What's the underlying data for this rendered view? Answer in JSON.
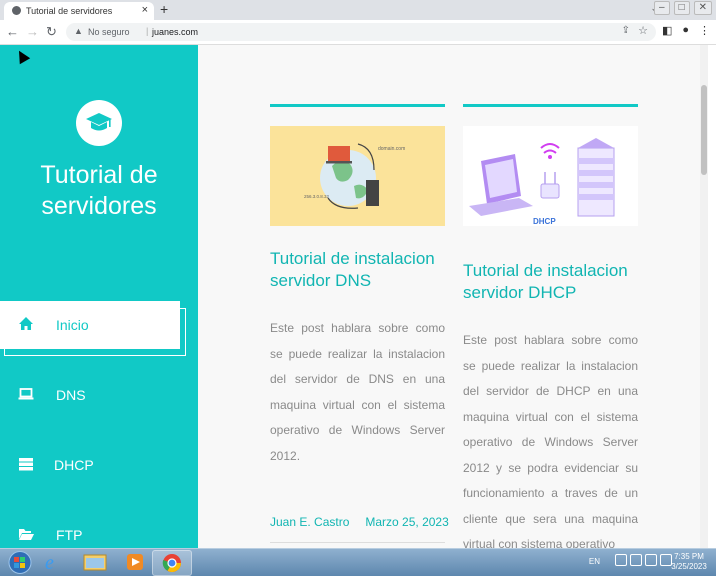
{
  "browser": {
    "tab_title": "Tutorial de servidores",
    "not_secure": "No seguro",
    "url": "juanes.com"
  },
  "sidebar": {
    "site_title": "Tutorial de servidores",
    "items": [
      {
        "label": "Inicio",
        "icon": "home-icon",
        "active": true
      },
      {
        "label": "DNS",
        "icon": "laptop-icon",
        "active": false
      },
      {
        "label": "DHCP",
        "icon": "server-icon",
        "active": false
      },
      {
        "label": "FTP",
        "icon": "folder-open-icon",
        "active": false
      }
    ]
  },
  "posts": [
    {
      "title": "Tutorial de instalacion servidor DNS",
      "image_caption": "domain.com",
      "image_ip": "256.3.0.8.32",
      "text": "Este post hablara sobre como se puede realizar la instalacion del servidor de DNS en una maquina virtual con el sistema operativo de Windows Server 2012.",
      "author": "Juan E. Castro",
      "date": "Marzo 25, 2023"
    },
    {
      "title": "Tutorial de instalacion servidor DHCP",
      "image_caption": "DHCP",
      "text": "Este post hablara sobre como se puede realizar la instalacion del servidor de DHCP en una maquina virtual con el sistema operativo de Windows Server 2012 y se podra evidenciar su funcionamiento a traves de un cliente que sera una maquina virtual con sistema operativo"
    }
  ],
  "taskbar": {
    "lang": "EN",
    "time": "7:35 PM",
    "date": "3/25/2023"
  },
  "colors": {
    "accent": "#11c9c6"
  }
}
